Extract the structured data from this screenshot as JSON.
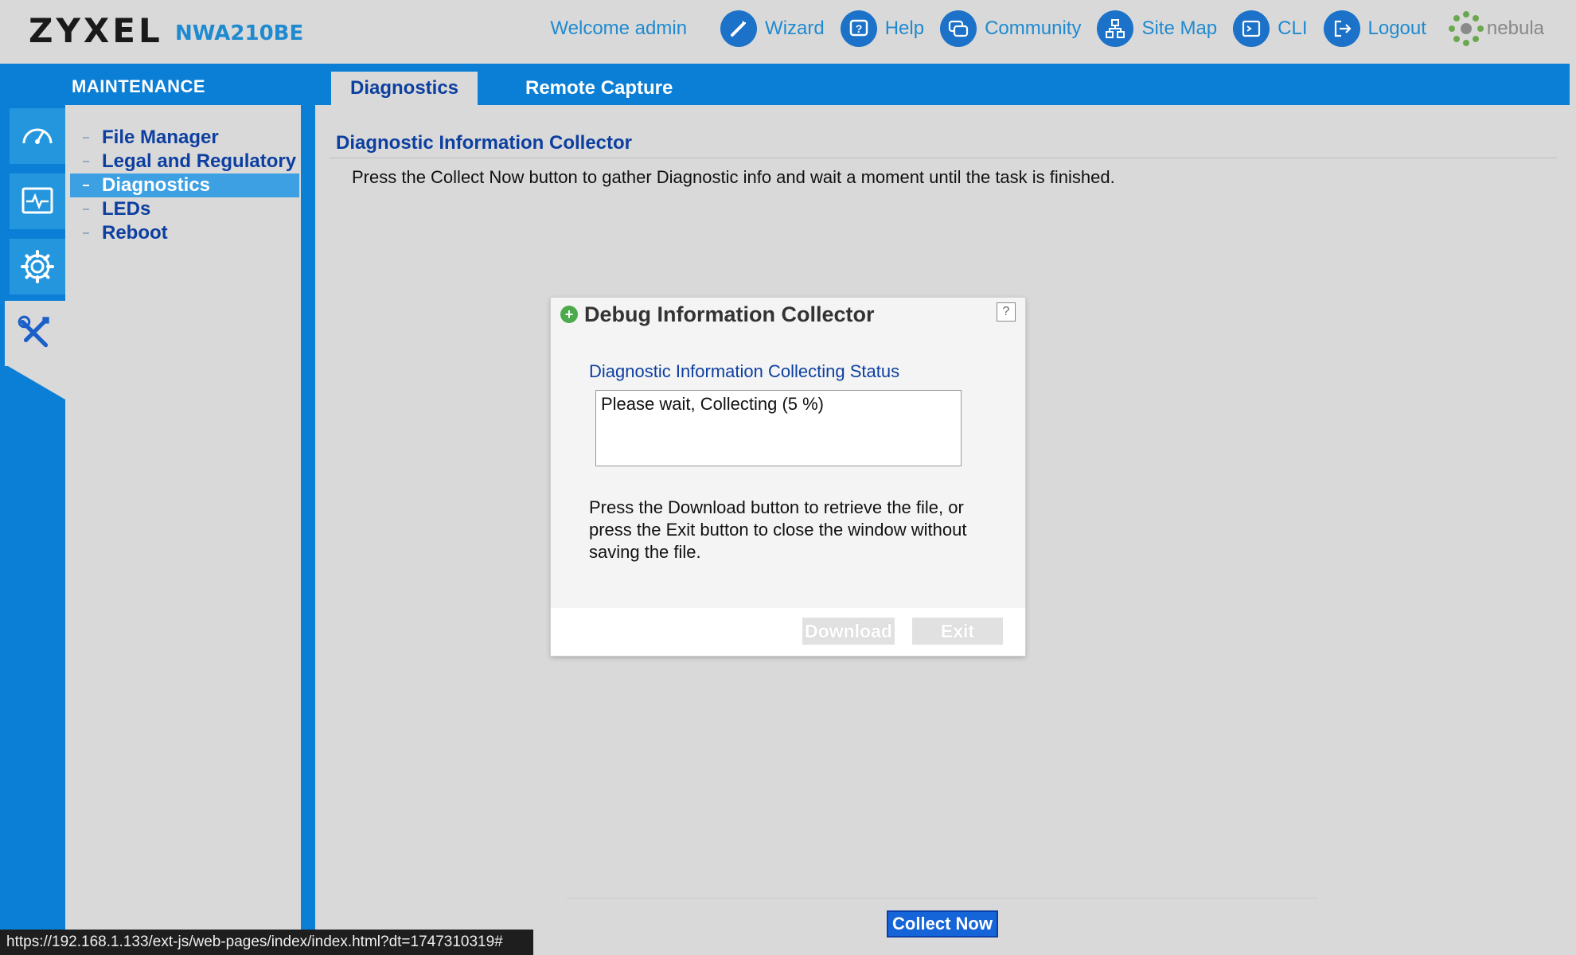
{
  "header": {
    "brand": "ZYXEL",
    "model": "NWA210BE",
    "welcome": "Welcome admin",
    "nav": [
      {
        "label": "Wizard",
        "icon": "wizard-icon"
      },
      {
        "label": "Help",
        "icon": "help-icon"
      },
      {
        "label": "Community",
        "icon": "community-icon"
      },
      {
        "label": "Site Map",
        "icon": "sitemap-icon"
      },
      {
        "label": "CLI",
        "icon": "cli-icon"
      },
      {
        "label": "Logout",
        "icon": "logout-icon"
      }
    ],
    "nebula": "nebula"
  },
  "section": {
    "title": "MAINTENANCE"
  },
  "tabs": [
    {
      "label": "Diagnostics",
      "active": true
    },
    {
      "label": "Remote Capture",
      "active": false
    }
  ],
  "sidebar": {
    "items": [
      {
        "label": "File Manager"
      },
      {
        "label": "Legal and Regulatory"
      },
      {
        "label": "Diagnostics",
        "active": true
      },
      {
        "label": "LEDs"
      },
      {
        "label": "Reboot"
      }
    ]
  },
  "content": {
    "title": "Diagnostic Information Collector",
    "description": "Press the Collect Now button to gather Diagnostic info and wait a moment until the task is finished.",
    "collect_button": "Collect Now"
  },
  "dialog": {
    "title": "Debug Information Collector",
    "help": "?",
    "status_label": "Diagnostic Information Collecting Status",
    "status_text": "Please wait, Collecting (5 %)",
    "instructions": "Press the Download button to retrieve the file, or press the Exit button to close the window without saving the file.",
    "download_button": "Download",
    "exit_button": "Exit"
  },
  "statusbar": {
    "url": "https://192.168.1.133/ext-js/web-pages/index/index.html?dt=1747310319#"
  },
  "colors": {
    "accent": "#0b7fd6",
    "link": "#1f8ad0",
    "heading": "#0d3fa0",
    "active_menu": "#3da0e2"
  }
}
